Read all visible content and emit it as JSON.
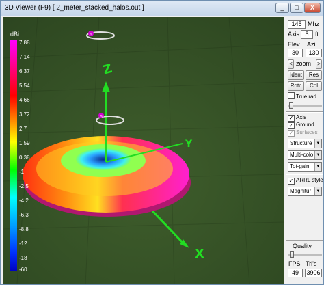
{
  "window": {
    "title": "3D Viewer (F9)    [  2_meter_stacked_halos.out ]",
    "buttons": [
      "_",
      "□",
      "X"
    ]
  },
  "scale": {
    "unit": "dBi",
    "values": [
      "7.88",
      "7.14",
      "6.37",
      "5.54",
      "4.66",
      "3.72",
      "2.7",
      "1.59",
      "0.38",
      "-1",
      "-2.5",
      "-4.2",
      "-6.3",
      "-8.8",
      "-12",
      "-18",
      "-60"
    ]
  },
  "axes": {
    "x": "X",
    "y": "Y",
    "z": "Z",
    "marker": "5"
  },
  "panel": {
    "freq_value": "145",
    "freq_unit": "Mhz",
    "axis_label": "Axis",
    "axis_value": "5",
    "axis_unit": "ft",
    "elev_label": "Elev.",
    "azi_label": "Azi.",
    "elev_value": "30",
    "azi_value": "130",
    "zoom_left": "<",
    "zoom_label": "zoom",
    "zoom_right": ">",
    "ident": "Ident",
    "res": "Res",
    "rotc": "Rotc",
    "col": "Col",
    "true_rad": "True rad.",
    "axis_chk": "Axis",
    "ground_chk": "Ground",
    "surfaces_chk": "Surfaces",
    "structure": "Structure",
    "multicolor": "Multi-colo",
    "totgain": "Tot-gain",
    "arrl": "ARRL style",
    "magnitude": "Magnitur",
    "quality": "Quality",
    "fps_label": "FPS",
    "tris_label": "Tri's",
    "fps_value": "49",
    "tris_value": "3906"
  },
  "colors": {
    "title_bar": "#c5d6ea",
    "ground": "#3d5a2a",
    "axis": "#22dd22"
  }
}
